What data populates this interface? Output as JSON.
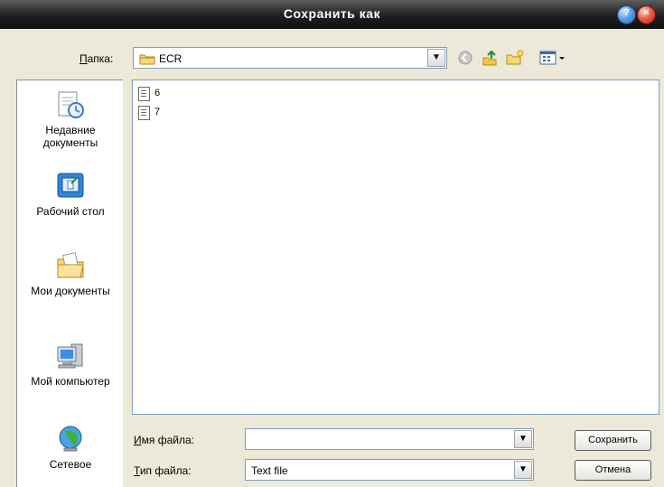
{
  "window": {
    "title": "Сохранить как"
  },
  "folder_bar": {
    "label": "Папка:",
    "label_access_key": "П",
    "label_rest": "апка:",
    "current_folder": "ECR"
  },
  "toolbar": {
    "back_icon": "back-icon",
    "up_icon": "up-folder-icon",
    "new_folder_icon": "new-folder-icon",
    "view_menu_icon": "view-menu-icon"
  },
  "places": [
    {
      "label": "Недавние документы",
      "icon": "recent-documents-icon"
    },
    {
      "label": "Рабочий стол",
      "icon": "desktop-icon"
    },
    {
      "label": "Мои документы",
      "icon": "my-documents-icon"
    },
    {
      "label": "Мой компьютер",
      "icon": "my-computer-icon"
    },
    {
      "label": "Сетевое",
      "icon": "network-icon"
    }
  ],
  "files": [
    {
      "name": "6"
    },
    {
      "name": "7"
    }
  ],
  "filename": {
    "label_access_key": "И",
    "label_rest": "мя файла:",
    "value": ""
  },
  "filetype": {
    "label_access_key": "Т",
    "label_rest": "ип файла:",
    "value": "Text file"
  },
  "buttons": {
    "save": "Сохранить",
    "cancel": "Отмена"
  },
  "colors": {
    "dialog_bg": "#ece9d8",
    "border_blue": "#7f9db9",
    "titlebar_dark": "#1f1f1f"
  }
}
